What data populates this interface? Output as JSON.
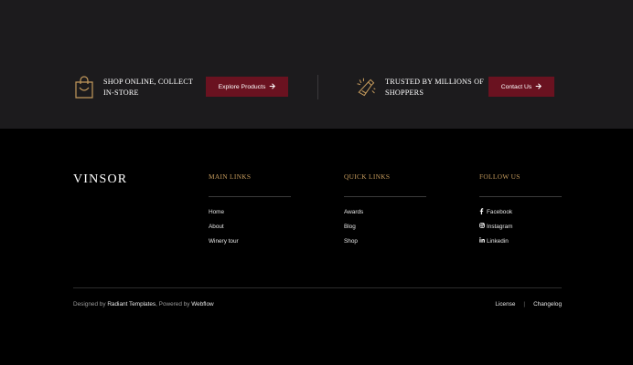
{
  "cta": {
    "left": {
      "icon": "shopping-bag-icon",
      "text": "SHOP ONLINE, COLLECT IN-STORE",
      "button": "Explore Products"
    },
    "right": {
      "icon": "wine-bottle-icon",
      "text": "TRUSTED BY MILLIONS OF SHOPPERS",
      "button": "Contact Us"
    }
  },
  "footer": {
    "logo": "VINSOR",
    "main_links": {
      "title": "MAIN LINKS",
      "items": [
        "Home",
        "About",
        "Winery tour"
      ]
    },
    "quick_links": {
      "title": "QUICK LINKS",
      "items": [
        "Awards",
        "Blog",
        "Shop"
      ]
    },
    "follow_us": {
      "title": "FOLLOW US",
      "items": [
        {
          "label": "Facebook",
          "icon": "facebook-icon"
        },
        {
          "label": "Instagram",
          "icon": "instagram-icon"
        },
        {
          "label": "Linkedin",
          "icon": "linkedin-icon"
        }
      ]
    },
    "credits": {
      "prefix": "Designed by",
      "designer": "Radiant Templates",
      "middle": ", Powered by",
      "platform": "Webflow"
    },
    "legal": {
      "license": "License",
      "separator": "|",
      "changelog": "Changelog"
    }
  },
  "colors": {
    "band_bg": "#1c1b1d",
    "footer_bg": "#000000",
    "accent_gold": "#c49a5c",
    "button_bg": "#6a1220"
  }
}
